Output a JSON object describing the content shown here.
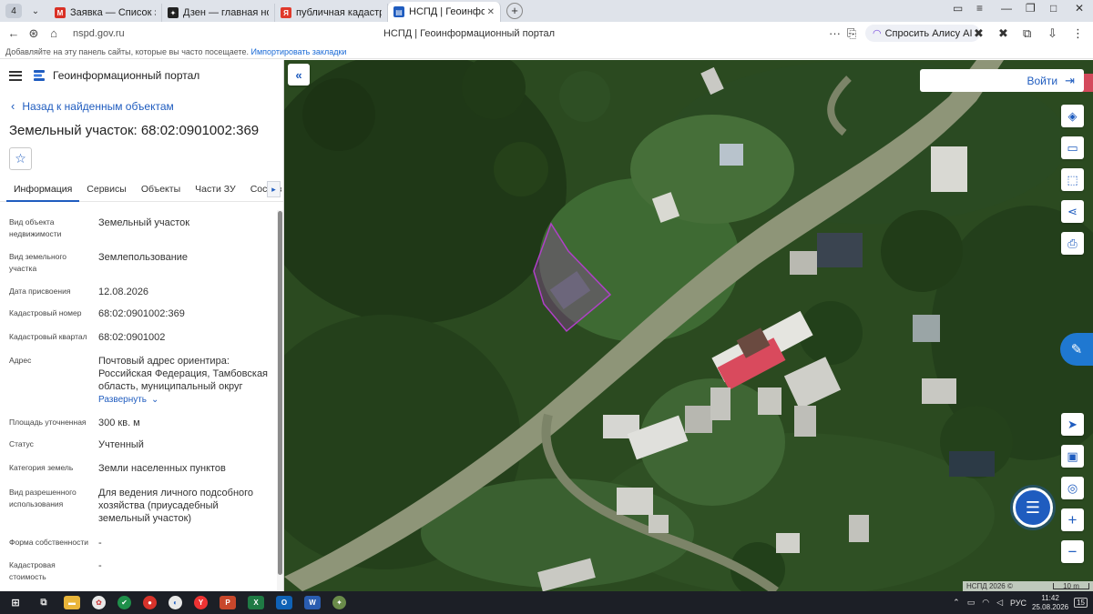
{
  "browser": {
    "tab_count": "4",
    "tabs": [
      {
        "title": "Заявка — Список заявок",
        "icon": "gmail-icon",
        "color": "#d93025",
        "glyph": "M"
      },
      {
        "title": "Дзен — главная новостная",
        "icon": "dzen-icon",
        "color": "#222222",
        "glyph": "✦"
      },
      {
        "title": "публичная кадастровая к",
        "icon": "yandex-icon",
        "color": "#e0392b",
        "glyph": "Я"
      },
      {
        "title": "НСПД | Геоинформационный",
        "icon": "nspd-icon",
        "color": "#1f5cbf",
        "glyph": "▤",
        "active": true
      }
    ],
    "url": "nspd.gov.ru",
    "page_title": "НСПД | Геоинформационный портал",
    "alice_label": "Спросить Алису AI",
    "bookmarks_hint": "Добавляйте на эту панель сайты, которые вы часто посещаете.",
    "bookmarks_import": "Импортировать закладки"
  },
  "panel": {
    "portal_name": "Геоинформационный портал",
    "back_label": "Назад к найденным объектам",
    "object_title": "Земельный участок: 68:02:0901002:369",
    "tabs": [
      "Информация",
      "Сервисы",
      "Объекты",
      "Части ЗУ",
      "Состав"
    ],
    "properties": [
      {
        "key": "Вид объекта недвижимости",
        "value": "Земельный участок"
      },
      {
        "key": "Вид земельного участка",
        "value": "Землепользование"
      },
      {
        "key": "Дата присвоения",
        "value": "12.08.2026"
      },
      {
        "key": "Кадастровый номер",
        "value": "68:02:0901002:369"
      },
      {
        "key": "Кадастровый квартал",
        "value": "68:02:0901002"
      },
      {
        "key": "Адрес",
        "value": "Почтовый адрес ориентира: Российская Федерация, Тамбовская область, муниципальный округ",
        "more": "Развернуть"
      },
      {
        "key": "Площадь уточненная",
        "value": "300 кв. м"
      },
      {
        "key": "Статус",
        "value": "Учтенный"
      },
      {
        "key": "Категория земель",
        "value": "Земли населенных пунктов"
      },
      {
        "key": "Вид разрешенного использования",
        "value": "Для ведения личного подсобного хозяйства (приусадебный земельный участок)"
      },
      {
        "key": "Форма собственности",
        "value": "-"
      },
      {
        "key": "Кадастровая стоимость",
        "value": "-"
      }
    ]
  },
  "map": {
    "login_label": "Войти",
    "attribution": "НСПД 2026 ©",
    "scale_label": "10 m",
    "parcel_color": "#b040c8"
  },
  "taskbar": {
    "language": "РУС",
    "time": "11:42",
    "date": "25.08.2026",
    "notifications": "15"
  }
}
